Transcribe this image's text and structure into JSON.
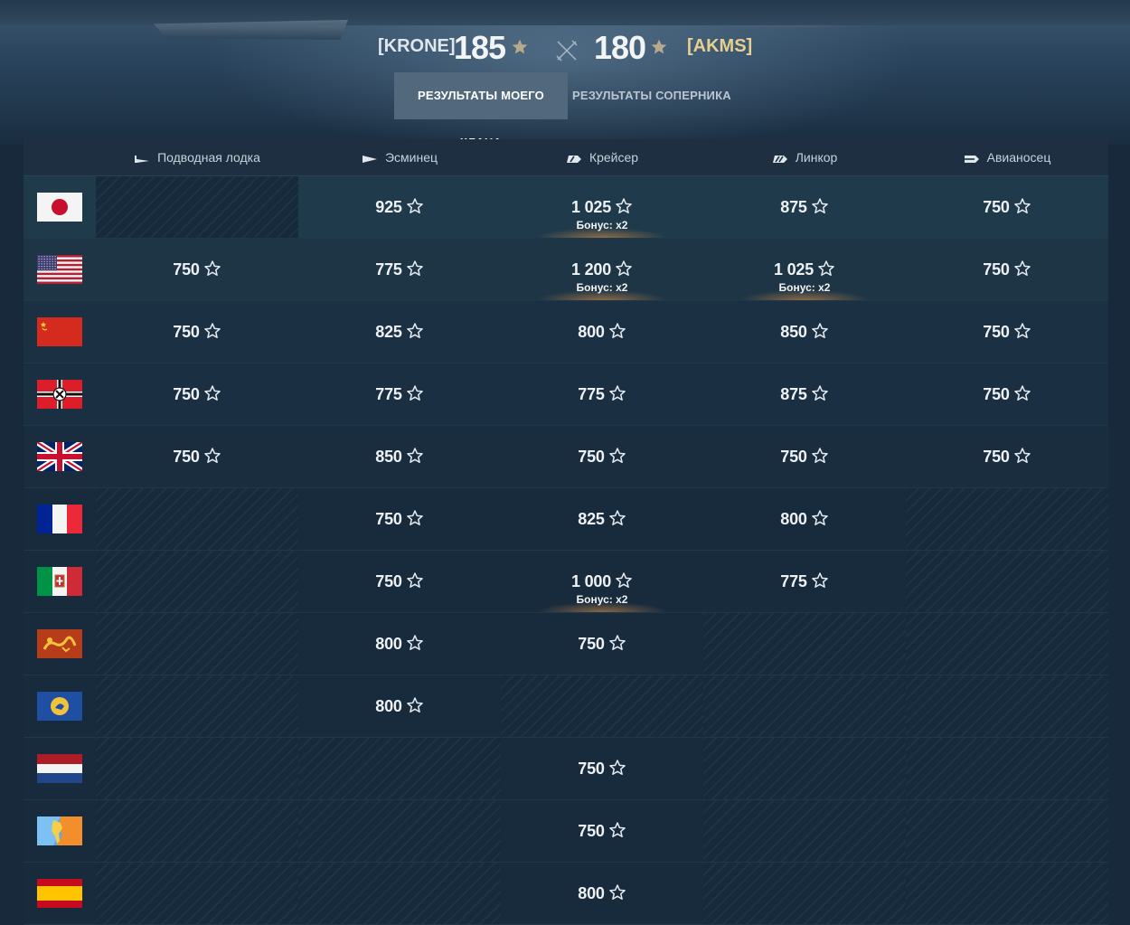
{
  "header": {
    "my_clan": "[KRONE]",
    "my_points": "185",
    "enemy_clan": "[AKMS]",
    "enemy_points": "180",
    "star_color": "#b6a98c",
    "enemy_color": "#e7cf8e"
  },
  "tabs": [
    {
      "label": "РЕЗУЛЬТАТЫ МОЕГО КЛАНА",
      "active": true
    },
    {
      "label": "РЕЗУЛЬТАТЫ СОПЕРНИКА",
      "active": false
    }
  ],
  "columns": [
    "Подводная лодка",
    "Эсминец",
    "Крейсер",
    "Линкор",
    "Авианосец"
  ],
  "column_icons": [
    "submarine-icon",
    "destroyer-icon",
    "cruiser-icon",
    "battleship-icon",
    "carrier-icon"
  ],
  "rows": [
    {
      "nation": "japan",
      "cells": [
        null,
        {
          "v": "925"
        },
        {
          "v": "1 025",
          "bonus": "Бонус: x2"
        },
        {
          "v": "875"
        },
        {
          "v": "750"
        }
      ]
    },
    {
      "nation": "usa",
      "cells": [
        {
          "v": "750"
        },
        {
          "v": "775"
        },
        {
          "v": "1 200",
          "bonus": "Бонус: x2"
        },
        {
          "v": "1 025",
          "bonus": "Бонус: x2"
        },
        {
          "v": "750"
        }
      ]
    },
    {
      "nation": "ussr",
      "cells": [
        {
          "v": "750"
        },
        {
          "v": "825"
        },
        {
          "v": "800"
        },
        {
          "v": "850"
        },
        {
          "v": "750"
        }
      ]
    },
    {
      "nation": "germany",
      "cells": [
        {
          "v": "750"
        },
        {
          "v": "775"
        },
        {
          "v": "775"
        },
        {
          "v": "875"
        },
        {
          "v": "750"
        }
      ]
    },
    {
      "nation": "uk",
      "cells": [
        {
          "v": "750"
        },
        {
          "v": "850"
        },
        {
          "v": "750"
        },
        {
          "v": "750"
        },
        {
          "v": "750"
        }
      ]
    },
    {
      "nation": "france",
      "cells": [
        null,
        {
          "v": "750"
        },
        {
          "v": "825"
        },
        {
          "v": "800"
        },
        null
      ]
    },
    {
      "nation": "italy",
      "cells": [
        null,
        {
          "v": "750"
        },
        {
          "v": "1 000",
          "bonus": "Бонус: x2"
        },
        {
          "v": "775"
        },
        null
      ]
    },
    {
      "nation": "pan_asia",
      "cells": [
        null,
        {
          "v": "800"
        },
        {
          "v": "750"
        },
        null,
        null
      ]
    },
    {
      "nation": "europe",
      "cells": [
        null,
        {
          "v": "800"
        },
        null,
        null,
        null
      ]
    },
    {
      "nation": "netherlands",
      "cells": [
        null,
        null,
        {
          "v": "750"
        },
        null,
        null
      ]
    },
    {
      "nation": "pan_america",
      "cells": [
        null,
        null,
        {
          "v": "750"
        },
        null,
        null
      ]
    },
    {
      "nation": "spain",
      "cells": [
        null,
        null,
        {
          "v": "800"
        },
        null,
        null
      ]
    }
  ]
}
